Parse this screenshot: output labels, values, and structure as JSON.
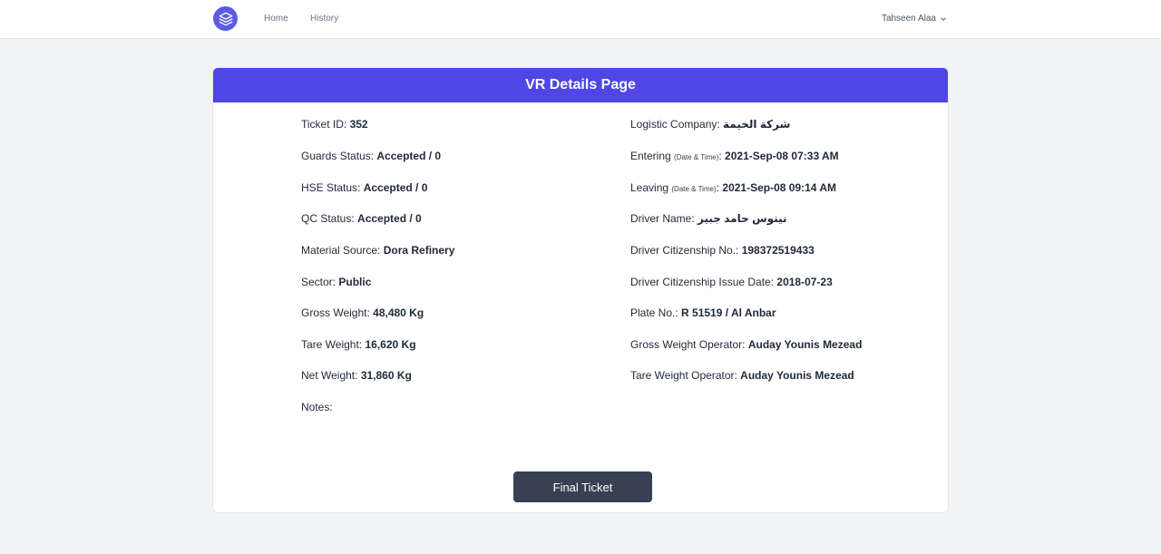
{
  "nav": {
    "home": "Home",
    "history": "History",
    "user": "Tahseen Alaa"
  },
  "card": {
    "title": "VR Details Page",
    "button": "Final Ticket"
  },
  "left": {
    "ticket_label": "Ticket ID: ",
    "ticket_value": "352",
    "guards_label": "Guards Status: ",
    "guards_value": "Accepted / 0",
    "hse_label": "HSE Status: ",
    "hse_value": "Accepted / 0",
    "qc_label": "QC Status: ",
    "qc_value": "Accepted / 0",
    "material_label": "Material Source: ",
    "material_value": "Dora Refinery",
    "sector_label": "Sector: ",
    "sector_value": "Public",
    "gross_label": "Gross Weight: ",
    "gross_value": "48,480 Kg",
    "tare_label": "Tare Weight: ",
    "tare_value": "16,620 Kg",
    "net_label": "Net Weight: ",
    "net_value": "31,860 Kg",
    "notes_label": "Notes: ",
    "notes_value": ""
  },
  "right": {
    "logistic_label": "Logistic Company: ",
    "logistic_value": "شركة الخيمة",
    "entering_label": "Entering ",
    "entering_hint": "(Date & Time)",
    "entering_value": "2021-Sep-08 07:33 AM",
    "leaving_label": "Leaving ",
    "leaving_hint": "(Date & Time)",
    "leaving_value": "2021-Sep-08 09:14 AM",
    "driver_label": "Driver Name: ",
    "driver_value": "نينوس حامد جبير",
    "citizen_label": "Driver Citizenship No.: ",
    "citizen_value": "198372519433",
    "issue_label": "Driver Citizenship Issue Date: ",
    "issue_value": "2018-07-23",
    "plate_label": "Plate No.: ",
    "plate_value": "R 51519 / Al Anbar",
    "gross_op_label": "Gross Weight Operator: ",
    "gross_op_value": "Auday Younis Mezead",
    "tare_op_label": "Tare Weight Operator: ",
    "tare_op_value": "Auday Younis Mezead"
  }
}
